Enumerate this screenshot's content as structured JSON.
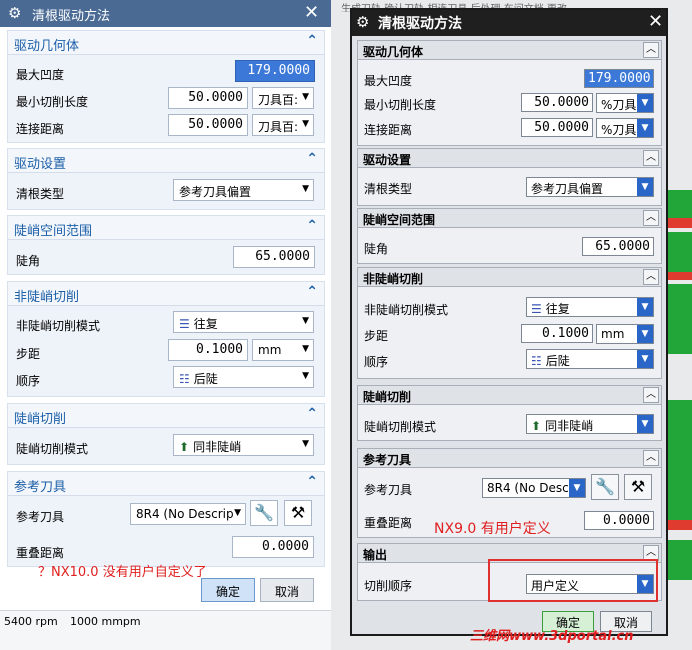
{
  "left": {
    "title": "清根驱动方法",
    "sections": {
      "geom": {
        "title": "驱动几何体"
      },
      "drive": {
        "title": "驱动设置"
      },
      "steep": {
        "title": "陡峭空间范围"
      },
      "nonsteep": {
        "title": "非陡峭切削"
      },
      "steepcut": {
        "title": "陡峭切削"
      },
      "reftool": {
        "title": "参考刀具"
      }
    },
    "max_concavity": {
      "label": "最大凹度",
      "value": "179.0000"
    },
    "min_cut_len": {
      "label": "最小切削长度",
      "value": "50.0000",
      "unit": "刀具百:"
    },
    "link_dist": {
      "label": "连接距离",
      "value": "50.0000",
      "unit": "刀具百:"
    },
    "cleanup_type": {
      "label": "清根类型",
      "value": "参考刀具偏置"
    },
    "steep_angle": {
      "label": "陡角",
      "value": "65.0000"
    },
    "nonsteep_mode": {
      "label": "非陡峭切削模式",
      "value": "往复"
    },
    "stepover": {
      "label": "步距",
      "value": "0.1000",
      "unit": "mm"
    },
    "order": {
      "label": "顺序",
      "value": "后陡"
    },
    "steep_mode": {
      "label": "陡峭切削模式",
      "value": "同非陡峭"
    },
    "ref_tool": {
      "label": "参考刀具",
      "value": "8R4 (No Descrip"
    },
    "overlap": {
      "label": "重叠距离",
      "value": "0.0000"
    },
    "ok": "确定",
    "cancel": "取消",
    "status": [
      "5400 rpm",
      "1000 mmpm"
    ]
  },
  "right": {
    "title": "清根驱动方法",
    "sections": {
      "geom": {
        "title": "驱动几何体"
      },
      "drive": {
        "title": "驱动设置"
      },
      "steep": {
        "title": "陡峭空间范围"
      },
      "nonsteep": {
        "title": "非陡峭切削"
      },
      "steepcut": {
        "title": "陡峭切削"
      },
      "reftool": {
        "title": "参考刀具"
      },
      "output": {
        "title": "输出"
      }
    },
    "max_concavity": {
      "label": "最大凹度",
      "value": "179.0000"
    },
    "min_cut_len": {
      "label": "最小切削长度",
      "value": "50.0000",
      "unit": "%刀具"
    },
    "link_dist": {
      "label": "连接距离",
      "value": "50.0000",
      "unit": "%刀具"
    },
    "cleanup_type": {
      "label": "清根类型",
      "value": "参考刀具偏置"
    },
    "steep_angle": {
      "label": "陡角",
      "value": "65.0000"
    },
    "nonsteep_mode": {
      "label": "非陡峭切削模式",
      "value": "往复"
    },
    "stepover": {
      "label": "步距",
      "value": "0.1000",
      "unit": "mm"
    },
    "order": {
      "label": "顺序",
      "value": "后陡"
    },
    "steep_mode": {
      "label": "陡峭切削模式",
      "value": "同非陡峭"
    },
    "ref_tool": {
      "label": "参考刀具",
      "value": "8R4 (No Desc"
    },
    "overlap": {
      "label": "重叠距离",
      "value": "0.0000"
    },
    "cut_order": {
      "label": "切削顺序",
      "value": "用户定义"
    },
    "ok": "确定",
    "cancel": "取消",
    "top_text": "生成刀轨  确认刀轨  相连刀具  后处理  车间文档  更改"
  },
  "notes": {
    "nx9": "NX9.0 有用户定义",
    "nx10": "？NX10.0 没有用户自定义了"
  },
  "watermark": "三维网www.3dportal.cn",
  "colors": {
    "left_title_bar": "#4a6a94",
    "left_section_title": "#1d5fa8",
    "right_title_bar": "#1f1f1f",
    "note": "#e02020",
    "selected_field": "#3b78d8"
  }
}
